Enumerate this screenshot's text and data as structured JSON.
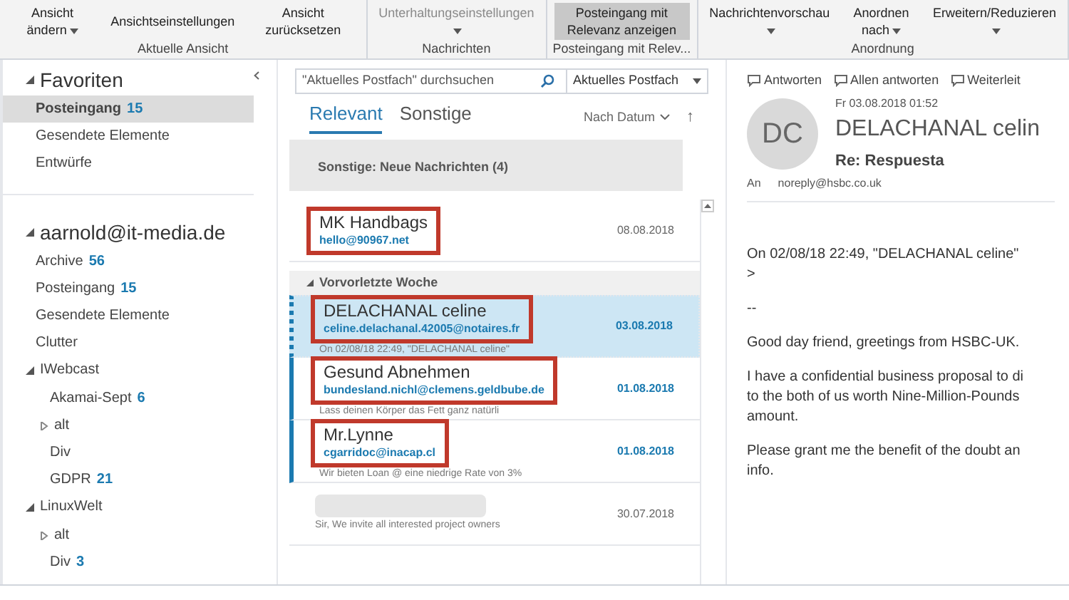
{
  "ribbon": {
    "groups": [
      {
        "label": "Aktuelle Ansicht",
        "buttons": [
          {
            "label": "Ansicht ändern",
            "dropdown": true,
            "disabled": false,
            "selected": false
          },
          {
            "label": "Ansichtseinstellungen",
            "dropdown": false,
            "disabled": false,
            "selected": false
          },
          {
            "label": "Ansicht zurücksetzen",
            "dropdown": false,
            "disabled": false,
            "selected": false
          }
        ]
      },
      {
        "label": "Nachrichten",
        "buttons": [
          {
            "label": "Unterhaltungseinstellungen",
            "dropdown": true,
            "disabled": true,
            "selected": false
          }
        ]
      },
      {
        "label": "Posteingang mit Relev...",
        "buttons": [
          {
            "label": "Posteingang mit Relevanz anzeigen",
            "dropdown": false,
            "disabled": false,
            "selected": true
          }
        ]
      },
      {
        "label": "Anordnung",
        "buttons": [
          {
            "label": "Nachrichtenvorschau",
            "dropdown": true,
            "disabled": false,
            "selected": false
          },
          {
            "label": "Anordnen nach",
            "dropdown": true,
            "disabled": false,
            "selected": false
          },
          {
            "label": "Erweitern/Reduzieren",
            "dropdown": true,
            "disabled": false,
            "selected": false
          }
        ]
      }
    ]
  },
  "folders": [
    {
      "name": "Favoriten",
      "expanded": true,
      "children": [
        {
          "name": "Posteingang",
          "count": "15",
          "selected": true
        },
        {
          "name": "Gesendete Elemente",
          "selected": false
        },
        {
          "name": "Entwürfe",
          "selected": false
        }
      ]
    },
    {
      "name": "aarnold@it-media.de",
      "expanded": true,
      "children": [
        {
          "name": "Archive",
          "count": "56",
          "selected": false
        },
        {
          "name": "Posteingang",
          "count": "15",
          "selected": false
        },
        {
          "name": "Gesendete Elemente",
          "selected": false
        },
        {
          "name": "Clutter",
          "selected": false
        },
        {
          "name": "IWebcast",
          "expanded": true,
          "selected": false,
          "children": [
            {
              "name": "Akamai-Sept",
              "count": "6",
              "selected": false
            },
            {
              "name": "alt",
              "expanded": false,
              "selected": false
            },
            {
              "name": "Div",
              "selected": false
            },
            {
              "name": "GDPR",
              "count": "21",
              "selected": false
            }
          ]
        },
        {
          "name": "LinuxWelt",
          "expanded": true,
          "selected": false,
          "children": [
            {
              "name": "alt",
              "expanded": false,
              "selected": false
            },
            {
              "name": "Div",
              "count": "3",
              "selected": false
            }
          ]
        }
      ]
    }
  ],
  "search": {
    "placeholder": "\"Aktuelles Postfach\" durchsuchen",
    "scope": "Aktuelles Postfach"
  },
  "tabs": [
    {
      "label": "Relevant",
      "selected": true
    },
    {
      "label": "Sonstige",
      "selected": false
    }
  ],
  "sort": {
    "label": "Nach Datum",
    "direction": "↑"
  },
  "banner": "Sonstige: Neue Nachrichten (4)",
  "messages": [
    {
      "kind": "message",
      "sender": "MK Handbags",
      "email": "hello@90967.net",
      "date": "08.08.2018",
      "selected": false,
      "unread": false,
      "highlighted": true
    },
    {
      "kind": "group_header",
      "label": "Vorvorletzte Woche"
    },
    {
      "kind": "message",
      "sender": "DELACHANAL celine",
      "email": "celine.delachanal.42005@notaires.fr",
      "preview": "On 02/08/18 22:49, \"DELACHANAL celine\"",
      "date": "03.08.2018",
      "selected": true,
      "unread": true,
      "highlighted": true
    },
    {
      "kind": "message",
      "sender": "Gesund Abnehmen",
      "email": "bundesland.nichl@clemens.geldbube.de",
      "preview": "Lass deinen Körper das Fett ganz natürli",
      "date": "01.08.2018",
      "selected": false,
      "unread": true,
      "highlighted": true
    },
    {
      "kind": "message",
      "sender": "Mr.Lynne",
      "email": "cgarridoc@inacap.cl",
      "preview": "Wir bieten Loan @ eine niedrige Rate von 3%",
      "date": "01.08.2018",
      "selected": false,
      "unread": true,
      "highlighted": true
    },
    {
      "kind": "message",
      "preview": "Sir,  We invite all interested project owners",
      "date": "30.07.2018",
      "selected": false,
      "unread": false,
      "highlighted": false
    }
  ],
  "reading": {
    "actions": [
      "Antworten",
      "Allen antworten",
      "Weiterleit"
    ],
    "initials": "DC",
    "datetime": "Fr 03.08.2018 01:52",
    "sender": "DELACHANAL celin",
    "subject": "Re: Respuesta",
    "to_label": "An",
    "to": "noreply@hsbc.co.uk",
    "body": [
      [
        "On 02/08/18 22:49, \"DELACHANAL celine\"",
        ">"
      ],
      [
        "--"
      ],
      [
        "Good day friend, greetings from HSBC-UK."
      ],
      [
        "I have a confidential business proposal to di",
        "to the both of us worth Nine-Million-Pounds",
        "amount."
      ],
      [
        "Please grant me the benefit of the doubt an",
        "info."
      ]
    ]
  }
}
